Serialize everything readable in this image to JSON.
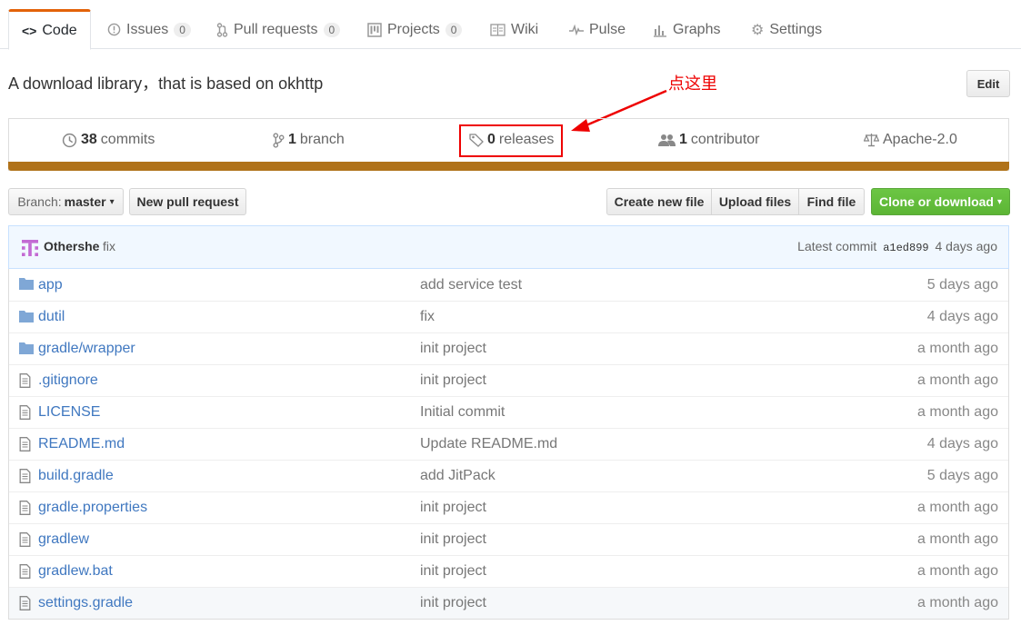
{
  "tabs": [
    {
      "label": "Code",
      "icon": "code-icon",
      "count": ""
    },
    {
      "label": "Issues",
      "icon": "issue-icon",
      "count": "0"
    },
    {
      "label": "Pull requests",
      "icon": "pull-request-icon",
      "count": "0"
    },
    {
      "label": "Projects",
      "icon": "project-icon",
      "count": "0"
    },
    {
      "label": "Wiki",
      "icon": "book-icon",
      "count": ""
    },
    {
      "label": "Pulse",
      "icon": "pulse-icon",
      "count": ""
    },
    {
      "label": "Graphs",
      "icon": "graph-icon",
      "count": ""
    },
    {
      "label": "Settings",
      "icon": "gear-icon",
      "count": ""
    }
  ],
  "repo": {
    "description": "A download library，that is based on okhttp",
    "edit_label": "Edit"
  },
  "annotation": {
    "text": "点这里",
    "color": "#e00000"
  },
  "summary": {
    "commits_count": "38",
    "commits_label": "commits",
    "branch_count": "1",
    "branch_label": "branch",
    "releases_count": "0",
    "releases_label": "releases",
    "contributor_count": "1",
    "contributor_label": "contributor",
    "license": "Apache-2.0",
    "language_color": "#b07219"
  },
  "filenav": {
    "branch_prefix": "Branch:",
    "branch_name": "master",
    "new_pr": "New pull request",
    "create_file": "Create new file",
    "upload_files": "Upload files",
    "find_file": "Find file",
    "clone": "Clone or download"
  },
  "latest_commit": {
    "author": "Othershe",
    "message": "fix",
    "prefix": "Latest commit",
    "sha": "a1ed899",
    "age": "4 days ago"
  },
  "files": [
    {
      "type": "dir",
      "name": "app",
      "message": "add service test",
      "age": "5 days ago"
    },
    {
      "type": "dir",
      "name": "dutil",
      "message": "fix",
      "age": "4 days ago"
    },
    {
      "type": "dir",
      "name": "gradle/wrapper",
      "message": "init project",
      "age": "a month ago"
    },
    {
      "type": "file",
      "name": ".gitignore",
      "message": "init project",
      "age": "a month ago"
    },
    {
      "type": "file",
      "name": "LICENSE",
      "message": "Initial commit",
      "age": "a month ago"
    },
    {
      "type": "file",
      "name": "README.md",
      "message": "Update README.md",
      "age": "4 days ago"
    },
    {
      "type": "file",
      "name": "build.gradle",
      "message": "add JitPack",
      "age": "5 days ago"
    },
    {
      "type": "file",
      "name": "gradle.properties",
      "message": "init project",
      "age": "a month ago"
    },
    {
      "type": "file",
      "name": "gradlew",
      "message": "init project",
      "age": "a month ago"
    },
    {
      "type": "file",
      "name": "gradlew.bat",
      "message": "init project",
      "age": "a month ago"
    },
    {
      "type": "file",
      "name": "settings.gradle",
      "message": "init project",
      "age": "a month ago"
    }
  ]
}
